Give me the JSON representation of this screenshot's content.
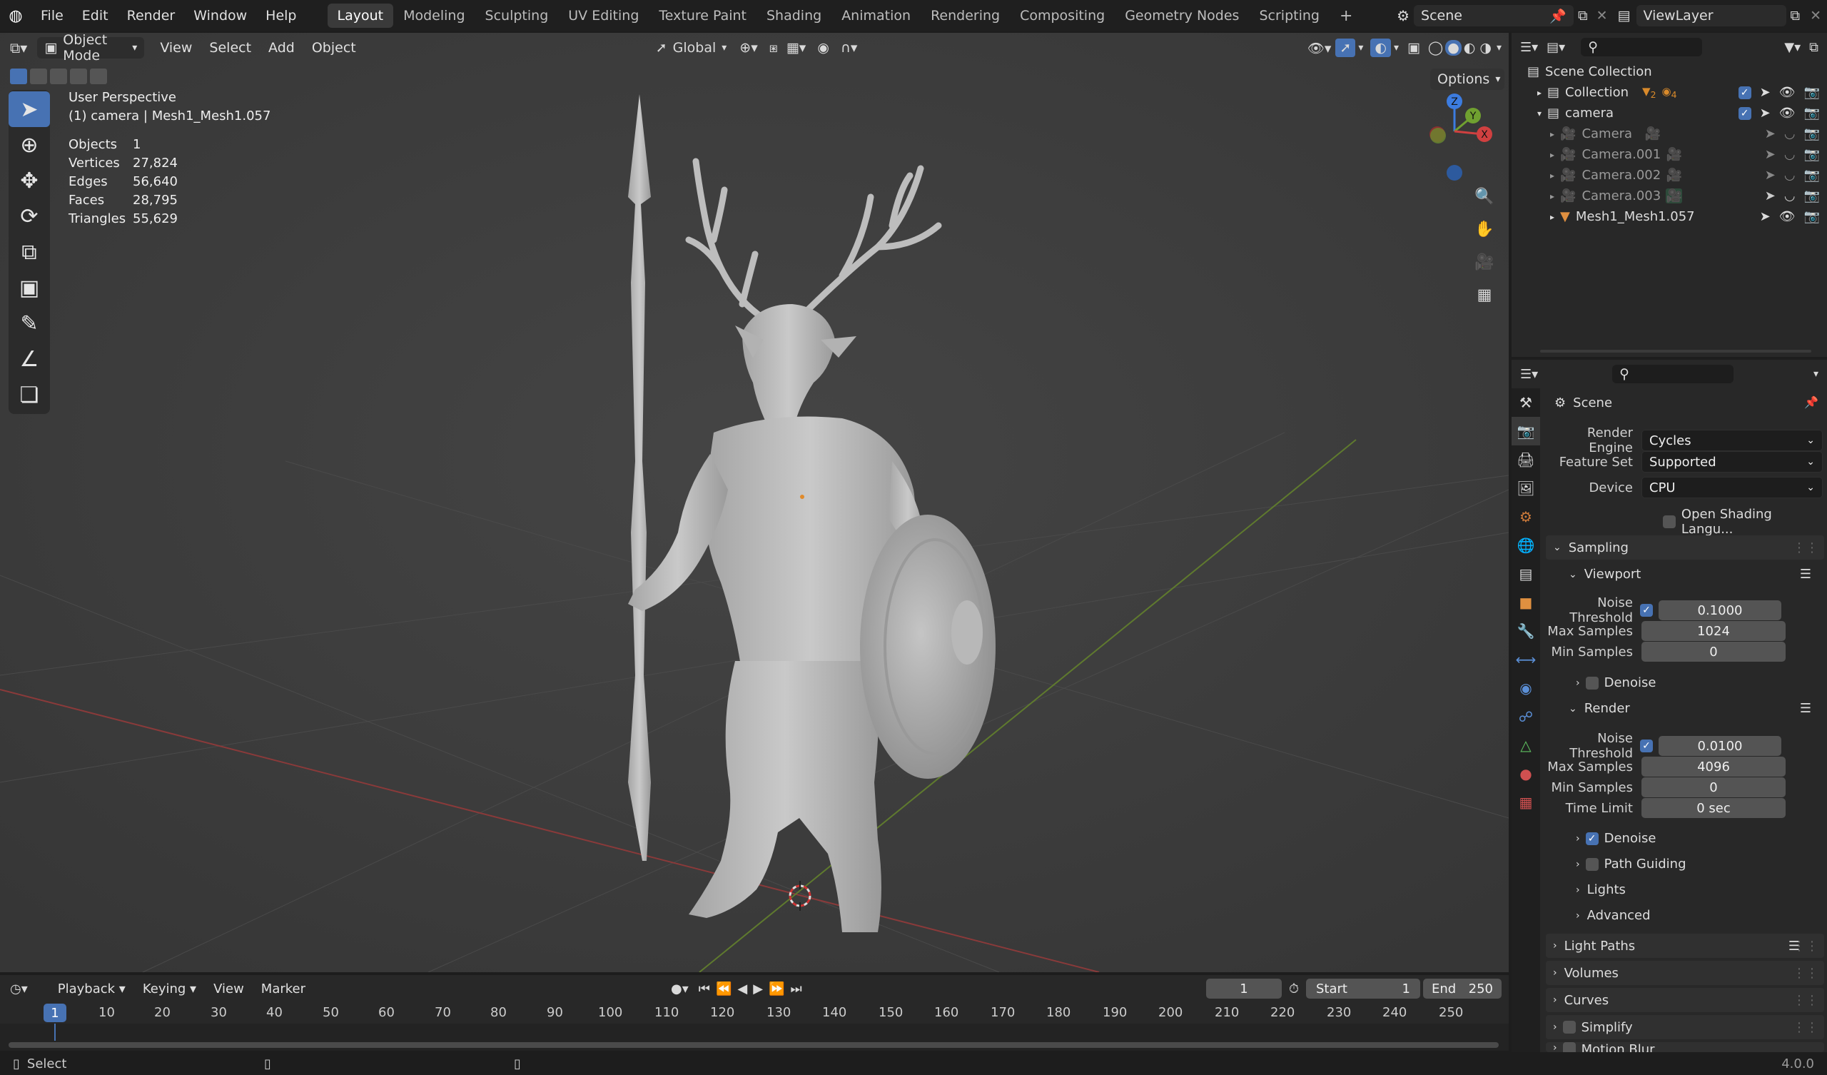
{
  "topbar": {
    "menus": [
      "File",
      "Edit",
      "Render",
      "Window",
      "Help"
    ],
    "workspaces": [
      "Layout",
      "Modeling",
      "Sculpting",
      "UV Editing",
      "Texture Paint",
      "Shading",
      "Animation",
      "Rendering",
      "Compositing",
      "Geometry Nodes",
      "Scripting"
    ],
    "active_workspace": "Layout",
    "add_tab": "+",
    "scene": "Scene",
    "view_layer": "ViewLayer"
  },
  "viewport_header": {
    "mode": "Object Mode",
    "menus": [
      "View",
      "Select",
      "Add",
      "Object"
    ],
    "orientation": "Global",
    "options": "Options"
  },
  "overlay_info": {
    "view_name": "User Perspective",
    "object_info": "(1) camera | Mesh1_Mesh1.057",
    "stats": [
      {
        "label": "Objects",
        "value": "1"
      },
      {
        "label": "Vertices",
        "value": "27,824"
      },
      {
        "label": "Edges",
        "value": "56,640"
      },
      {
        "label": "Faces",
        "value": "28,795"
      },
      {
        "label": "Triangles",
        "value": "55,629"
      }
    ]
  },
  "gizmo": {
    "z": "Z",
    "y": "Y",
    "x": "X"
  },
  "outliner": {
    "root": "Scene Collection",
    "rows": [
      {
        "name": "Collection",
        "badge1": "2",
        "badge2": "4"
      },
      {
        "name": "camera"
      },
      {
        "name": "Camera"
      },
      {
        "name": "Camera.001"
      },
      {
        "name": "Camera.002"
      },
      {
        "name": "Camera.003"
      },
      {
        "name": "Mesh1_Mesh1.057"
      }
    ]
  },
  "properties": {
    "context": "Scene",
    "render_engine_label": "Render Engine",
    "render_engine": "Cycles",
    "feature_set_label": "Feature Set",
    "feature_set": "Supported",
    "device_label": "Device",
    "device": "CPU",
    "osl": "Open Shading Langu...",
    "sampling": "Sampling",
    "viewport": "Viewport",
    "vp_noise_label": "Noise Threshold",
    "vp_noise": "0.1000",
    "vp_max_label": "Max Samples",
    "vp_max": "1024",
    "vp_min_label": "Min Samples",
    "vp_min": "0",
    "vp_denoise": "Denoise",
    "render": "Render",
    "r_noise_label": "Noise Threshold",
    "r_noise": "0.0100",
    "r_max_label": "Max Samples",
    "r_max": "4096",
    "r_min_label": "Min Samples",
    "r_min": "0",
    "r_time_label": "Time Limit",
    "r_time": "0 sec",
    "r_denoise": "Denoise",
    "path_guiding": "Path Guiding",
    "lights": "Lights",
    "advanced": "Advanced",
    "light_paths": "Light Paths",
    "volumes": "Volumes",
    "curves": "Curves",
    "simplify": "Simplify",
    "motion_blur": "Motion Blur"
  },
  "timeline": {
    "menus": [
      "Playback",
      "Keying",
      "View",
      "Marker"
    ],
    "current_frame": "1",
    "start_label": "Start",
    "start": "1",
    "end_label": "End",
    "end": "250",
    "ticks": [
      "1",
      "10",
      "20",
      "30",
      "40",
      "50",
      "60",
      "70",
      "80",
      "90",
      "100",
      "110",
      "120",
      "130",
      "140",
      "150",
      "160",
      "170",
      "180",
      "190",
      "200",
      "210",
      "220",
      "230",
      "240",
      "250"
    ]
  },
  "statusbar": {
    "hint": "Select",
    "version": "4.0.0"
  }
}
